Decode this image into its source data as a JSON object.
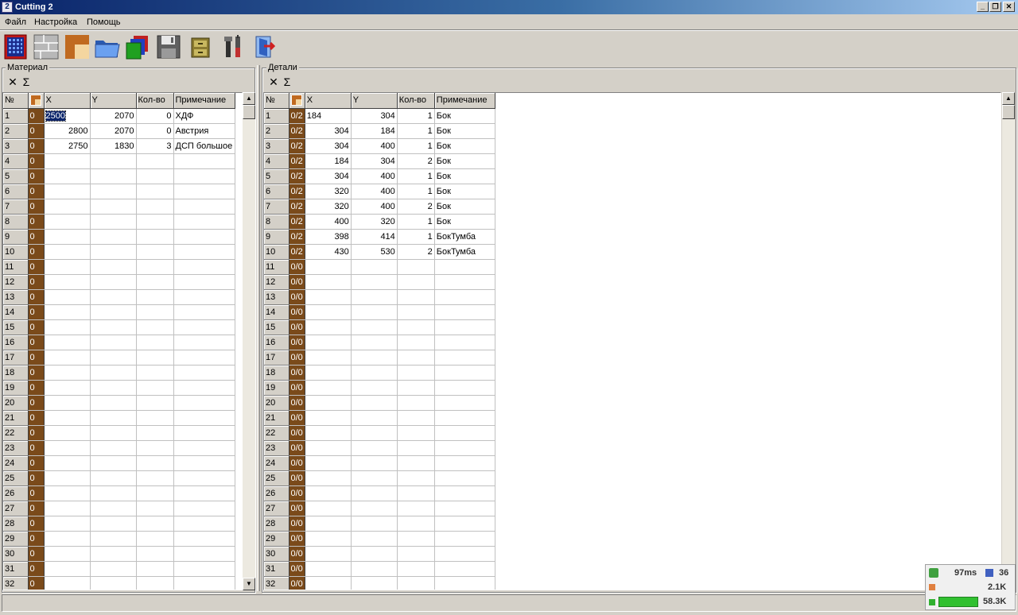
{
  "window": {
    "title": "Cutting 2",
    "app_icon_text": "2",
    "btn_minimize": "_",
    "btn_restore": "❐",
    "btn_close": "✕"
  },
  "menu": [
    "Файл",
    "Настройка",
    "Помощь"
  ],
  "toolbar": [
    "calculator-icon",
    "sheet-layout-icon",
    "material-texture-icon",
    "open-folder-icon",
    "open-multiple-icon",
    "save-icon",
    "archive-icon",
    "tools-icon",
    "exit-icon"
  ],
  "material": {
    "group_title": "Материал",
    "clear_symbol": "✕",
    "sum_symbol": "Σ",
    "columns": [
      "№",
      "",
      "X",
      "Y",
      "Кол-во",
      "Примечание"
    ],
    "rows": [
      {
        "n": "1",
        "t": "0",
        "x": "2500",
        "y": "2070",
        "q": "0",
        "note": "ХДФ"
      },
      {
        "n": "2",
        "t": "0",
        "x": "2800",
        "y": "2070",
        "q": "0",
        "note": "Австрия"
      },
      {
        "n": "3",
        "t": "0",
        "x": "2750",
        "y": "1830",
        "q": "3",
        "note": "ДСП большое"
      },
      {
        "n": "4",
        "t": "0"
      },
      {
        "n": "5",
        "t": "0"
      },
      {
        "n": "6",
        "t": "0"
      },
      {
        "n": "7",
        "t": "0"
      },
      {
        "n": "8",
        "t": "0"
      },
      {
        "n": "9",
        "t": "0"
      },
      {
        "n": "10",
        "t": "0"
      },
      {
        "n": "11",
        "t": "0"
      },
      {
        "n": "12",
        "t": "0"
      },
      {
        "n": "13",
        "t": "0"
      },
      {
        "n": "14",
        "t": "0"
      },
      {
        "n": "15",
        "t": "0"
      },
      {
        "n": "16",
        "t": "0"
      },
      {
        "n": "17",
        "t": "0"
      },
      {
        "n": "18",
        "t": "0"
      },
      {
        "n": "19",
        "t": "0"
      },
      {
        "n": "20",
        "t": "0"
      },
      {
        "n": "21",
        "t": "0"
      },
      {
        "n": "22",
        "t": "0"
      },
      {
        "n": "23",
        "t": "0"
      },
      {
        "n": "24",
        "t": "0"
      },
      {
        "n": "25",
        "t": "0"
      },
      {
        "n": "26",
        "t": "0"
      },
      {
        "n": "27",
        "t": "0"
      },
      {
        "n": "28",
        "t": "0"
      },
      {
        "n": "29",
        "t": "0"
      },
      {
        "n": "30",
        "t": "0"
      },
      {
        "n": "31",
        "t": "0"
      },
      {
        "n": "32",
        "t": "0"
      }
    ]
  },
  "details": {
    "group_title": "Детали",
    "clear_symbol": "✕",
    "sum_symbol": "Σ",
    "columns": [
      "№",
      "",
      "X",
      "Y",
      "Кол-во",
      "Примечание"
    ],
    "rows": [
      {
        "n": "1",
        "t": "0/2",
        "x": "184",
        "y": "304",
        "q": "1",
        "note": "Бок"
      },
      {
        "n": "2",
        "t": "0/2",
        "x": "304",
        "y": "184",
        "q": "1",
        "note": "Бок"
      },
      {
        "n": "3",
        "t": "0/2",
        "x": "304",
        "y": "400",
        "q": "1",
        "note": "Бок"
      },
      {
        "n": "4",
        "t": "0/2",
        "x": "184",
        "y": "304",
        "q": "2",
        "note": "Бок"
      },
      {
        "n": "5",
        "t": "0/2",
        "x": "304",
        "y": "400",
        "q": "1",
        "note": "Бок"
      },
      {
        "n": "6",
        "t": "0/2",
        "x": "320",
        "y": "400",
        "q": "1",
        "note": "Бок"
      },
      {
        "n": "7",
        "t": "0/2",
        "x": "320",
        "y": "400",
        "q": "2",
        "note": "Бок"
      },
      {
        "n": "8",
        "t": "0/2",
        "x": "400",
        "y": "320",
        "q": "1",
        "note": "Бок"
      },
      {
        "n": "9",
        "t": "0/2",
        "x": "398",
        "y": "414",
        "q": "1",
        "note": "БокТумба"
      },
      {
        "n": "10",
        "t": "0/2",
        "x": "430",
        "y": "530",
        "q": "2",
        "note": "БокТумба"
      },
      {
        "n": "11",
        "t": "0/0"
      },
      {
        "n": "12",
        "t": "0/0"
      },
      {
        "n": "13",
        "t": "0/0"
      },
      {
        "n": "14",
        "t": "0/0"
      },
      {
        "n": "15",
        "t": "0/0"
      },
      {
        "n": "16",
        "t": "0/0"
      },
      {
        "n": "17",
        "t": "0/0"
      },
      {
        "n": "18",
        "t": "0/0"
      },
      {
        "n": "19",
        "t": "0/0"
      },
      {
        "n": "20",
        "t": "0/0"
      },
      {
        "n": "21",
        "t": "0/0"
      },
      {
        "n": "22",
        "t": "0/0"
      },
      {
        "n": "23",
        "t": "0/0"
      },
      {
        "n": "24",
        "t": "0/0"
      },
      {
        "n": "25",
        "t": "0/0"
      },
      {
        "n": "26",
        "t": "0/0"
      },
      {
        "n": "27",
        "t": "0/0"
      },
      {
        "n": "28",
        "t": "0/0"
      },
      {
        "n": "29",
        "t": "0/0"
      },
      {
        "n": "30",
        "t": "0/0"
      },
      {
        "n": "31",
        "t": "0/0"
      },
      {
        "n": "32",
        "t": "0/0"
      }
    ]
  },
  "tray": {
    "ping": "97ms",
    "count": "36",
    "upload": "2.1K",
    "download": "58.3K"
  }
}
